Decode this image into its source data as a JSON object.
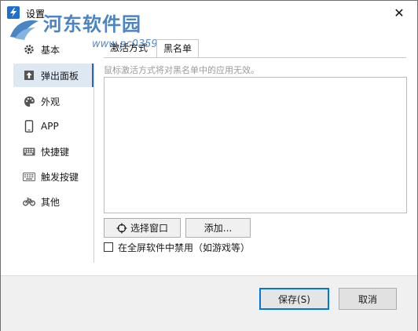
{
  "window": {
    "title": "设置",
    "close_glyph": "✕"
  },
  "watermark": {
    "main": "河东软件园",
    "sub": "www.pc0359.cn"
  },
  "sidebar": {
    "items": [
      {
        "label": "基本",
        "icon": "gear-icon"
      },
      {
        "label": "弹出面板",
        "icon": "popup-panel-icon",
        "active": true
      },
      {
        "label": "外观",
        "icon": "palette-icon"
      },
      {
        "label": "APP",
        "icon": "phone-icon"
      },
      {
        "label": "快捷键",
        "icon": "keyboard-icon"
      },
      {
        "label": "触发按键",
        "icon": "keyboard-trigger-icon"
      },
      {
        "label": "其他",
        "icon": "bicycle-icon"
      }
    ]
  },
  "tabs": [
    {
      "label": "激活方式"
    },
    {
      "label": "黑名单",
      "active": true
    }
  ],
  "main": {
    "hint": "鼠标激活方式将对黑名单中的应用无效。",
    "select_window_label": "选择窗口",
    "add_label": "添加...",
    "disable_fullscreen_label": "在全屏软件中禁用（如游戏等）"
  },
  "footer": {
    "save_label": "保存(S)",
    "cancel_label": "取消"
  },
  "colors": {
    "accent": "#2b66b3",
    "active_bg": "#dde8f3",
    "watermark": "#2c6fb8"
  }
}
